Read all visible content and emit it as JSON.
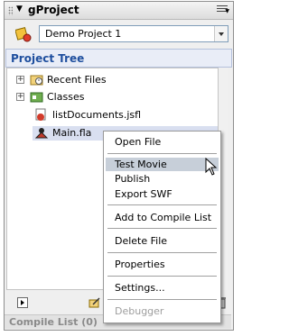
{
  "panel": {
    "title": "gProject",
    "collapse_glyph": "▼"
  },
  "project_select": {
    "value": "Demo Project 1"
  },
  "tree": {
    "header": "Project Tree",
    "expander_glyph": "+",
    "items": [
      {
        "label": "Recent Files",
        "icon": "folder-clock-icon",
        "expandable": true
      },
      {
        "label": "Classes",
        "icon": "classes-folder-icon",
        "expandable": true
      },
      {
        "label": "listDocuments.jsfl",
        "icon": "jsfl-file-icon",
        "expandable": false
      },
      {
        "label": "Main.fla",
        "icon": "fla-file-icon",
        "expandable": false,
        "selected": true
      }
    ]
  },
  "context_menu": {
    "items": [
      {
        "label": "Open File"
      },
      {
        "label": "Test Movie",
        "highlighted": true
      },
      {
        "label": "Publish"
      },
      {
        "label": "Export SWF"
      },
      {
        "label": "Add to Compile List"
      },
      {
        "label": "Delete File"
      },
      {
        "label": "Properties"
      },
      {
        "label": "Settings..."
      },
      {
        "label": "Debugger",
        "disabled": true
      }
    ]
  },
  "compile_list": {
    "label": "Compile List (0)"
  },
  "colors": {
    "header_text": "#1f4f9e",
    "selection_bg": "#d9dff0",
    "menu_highlight": "#c7cfd9"
  }
}
